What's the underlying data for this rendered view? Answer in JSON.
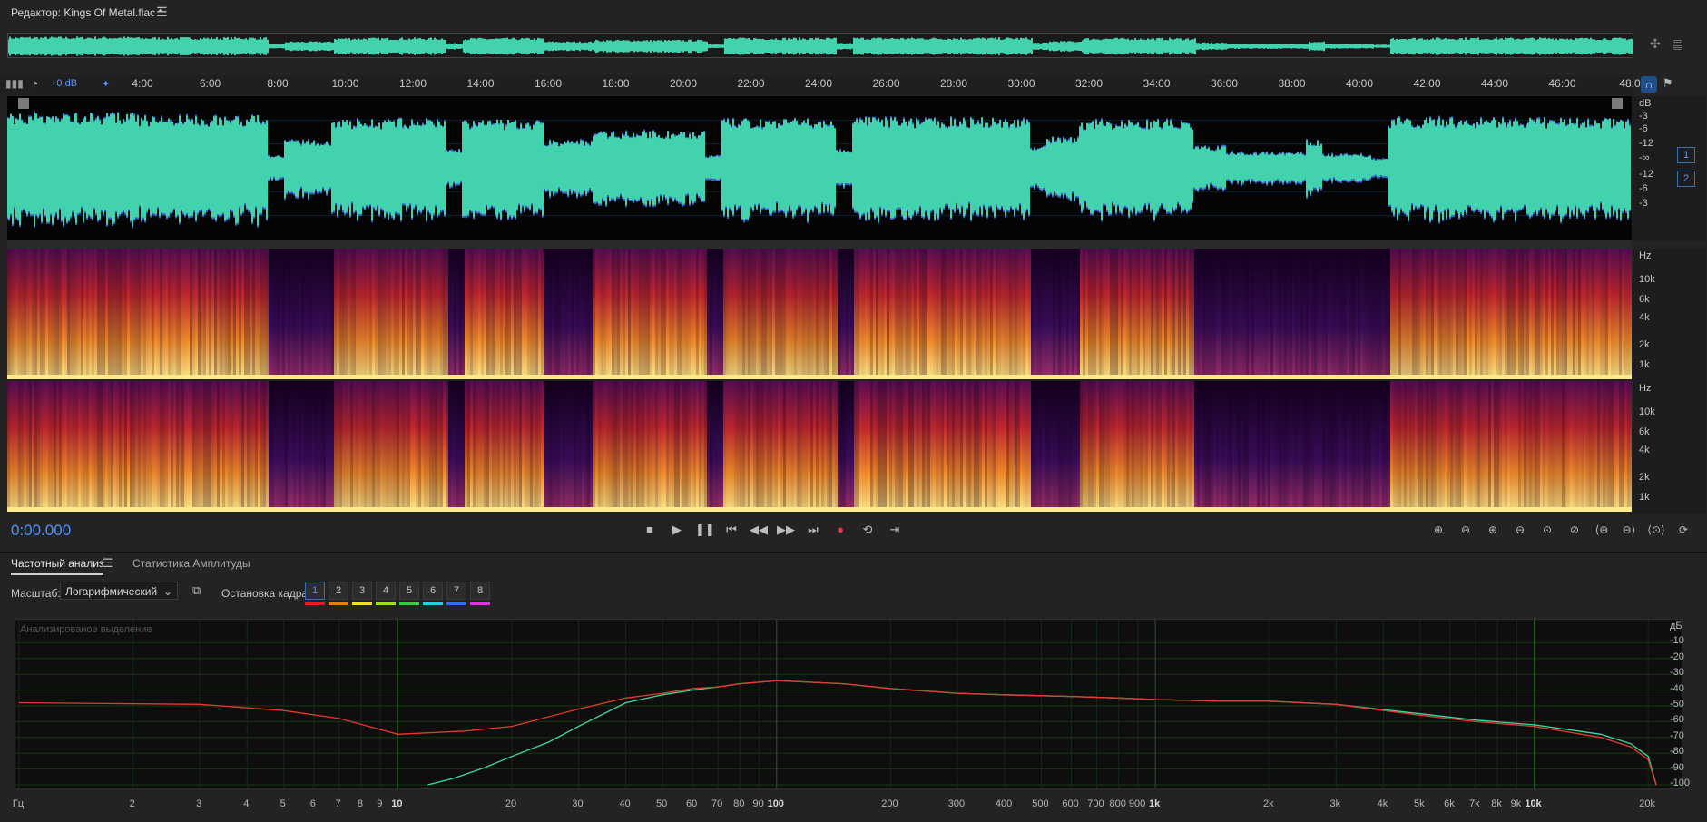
{
  "title": {
    "text": "Редактор: Kings Of Metal.flac *",
    "menu_icon": "hamburger-menu-icon"
  },
  "colors": {
    "waveform": "#42d3ae",
    "waveform_edge": "#3a5fd0",
    "accent": "#4c92ff",
    "curve_left": "#3dd9a3",
    "curve_right": "#e23b2e",
    "record": "#e33b3b"
  },
  "ruler": {
    "db_readout": "+0 dB",
    "labels": [
      "4:00",
      "6:00",
      "8:00",
      "10:00",
      "12:00",
      "14:00",
      "16:00",
      "18:00",
      "20:00",
      "22:00",
      "24:00",
      "26:00",
      "28:00",
      "30:00",
      "32:00",
      "34:00",
      "36:00",
      "38:00",
      "40:00",
      "42:00",
      "44:00",
      "46:00",
      "48:0"
    ]
  },
  "wave_scale": [
    "dB",
    "-3",
    "-6",
    "-12",
    "-∞",
    "-12",
    "-6",
    "-3"
  ],
  "spectral_scale": [
    "Hz",
    "10k",
    "6k",
    "4k",
    "2k",
    "1k"
  ],
  "channels": [
    "1",
    "2"
  ],
  "transport": {
    "time": "0:00.000",
    "buttons": [
      {
        "name": "stop-button",
        "icon": "■"
      },
      {
        "name": "play-button",
        "icon": "▶"
      },
      {
        "name": "pause-button",
        "icon": "❚❚"
      },
      {
        "name": "skip-to-start-button",
        "icon": "⏮"
      },
      {
        "name": "rewind-button",
        "icon": "◀◀"
      },
      {
        "name": "fast-forward-button",
        "icon": "▶▶"
      },
      {
        "name": "skip-to-end-button",
        "icon": "⏭"
      },
      {
        "name": "record-button",
        "icon": "●"
      },
      {
        "name": "loop-button",
        "icon": "⟲"
      },
      {
        "name": "skip-selection-button",
        "icon": "⇥"
      }
    ],
    "zoom_buttons": [
      {
        "name": "zoom-in-amplitude-button",
        "icon": "⊕"
      },
      {
        "name": "zoom-out-amplitude-button",
        "icon": "⊖"
      },
      {
        "name": "zoom-in-time-button",
        "icon": "⊕"
      },
      {
        "name": "zoom-out-time-button",
        "icon": "⊖"
      },
      {
        "name": "zoom-selection-button",
        "icon": "⊙"
      },
      {
        "name": "zoom-out-full-button",
        "icon": "⊘"
      },
      {
        "name": "zoom-in-point-button",
        "icon": "⟨⊕"
      },
      {
        "name": "zoom-out-point-button",
        "icon": "⊖⟩"
      },
      {
        "name": "zoom-reset-button",
        "icon": "⟨⊙⟩"
      },
      {
        "name": "zoom-full-button",
        "icon": "⟳"
      },
      {
        "name": "zoom-extra-button",
        "icon": "⊡"
      }
    ]
  },
  "panel": {
    "tabs": [
      {
        "label": "Частотный анализ",
        "active": true
      },
      {
        "label": "Статистика Амплитуды",
        "active": false
      }
    ],
    "scale_label": "Масштаб:",
    "scale_value": "Логарифмический",
    "freeze_label": "Остановка кадра:",
    "frames": [
      {
        "label": "1",
        "color": "#e02020"
      },
      {
        "label": "2",
        "color": "#f07c10"
      },
      {
        "label": "3",
        "color": "#f0e020"
      },
      {
        "label": "4",
        "color": "#a0e020"
      },
      {
        "label": "5",
        "color": "#30d040"
      },
      {
        "label": "6",
        "color": "#20d0e0"
      },
      {
        "label": "7",
        "color": "#3070f0"
      },
      {
        "label": "8",
        "color": "#e030e0"
      }
    ]
  },
  "freq_analysis": {
    "caption": "Анализированое выделение",
    "db_labels": [
      "дБ",
      "-10",
      "-20",
      "-30",
      "-40",
      "-50",
      "-60",
      "-70",
      "-80",
      "-90",
      "-100"
    ],
    "x_labels": [
      {
        "t": "Гц",
        "f": 1.0
      },
      {
        "t": "2",
        "f": 2
      },
      {
        "t": "3",
        "f": 3
      },
      {
        "t": "4",
        "f": 4
      },
      {
        "t": "5",
        "f": 5
      },
      {
        "t": "6",
        "f": 6
      },
      {
        "t": "7",
        "f": 7
      },
      {
        "t": "8",
        "f": 8
      },
      {
        "t": "9",
        "f": 9
      },
      {
        "t": "10",
        "f": 10,
        "b": true
      },
      {
        "t": "20",
        "f": 20
      },
      {
        "t": "30",
        "f": 30
      },
      {
        "t": "40",
        "f": 40
      },
      {
        "t": "50",
        "f": 50
      },
      {
        "t": "60",
        "f": 60
      },
      {
        "t": "70",
        "f": 70
      },
      {
        "t": "80",
        "f": 80
      },
      {
        "t": "90",
        "f": 90
      },
      {
        "t": "100",
        "f": 100,
        "b": true
      },
      {
        "t": "200",
        "f": 200
      },
      {
        "t": "300",
        "f": 300
      },
      {
        "t": "400",
        "f": 400
      },
      {
        "t": "500",
        "f": 500
      },
      {
        "t": "600",
        "f": 600
      },
      {
        "t": "700",
        "f": 700
      },
      {
        "t": "800",
        "f": 800
      },
      {
        "t": "900",
        "f": 900
      },
      {
        "t": "1k",
        "f": 1000,
        "b": true
      },
      {
        "t": "2k",
        "f": 2000
      },
      {
        "t": "3k",
        "f": 3000
      },
      {
        "t": "4k",
        "f": 4000
      },
      {
        "t": "5k",
        "f": 5000
      },
      {
        "t": "6k",
        "f": 6000
      },
      {
        "t": "7k",
        "f": 7000
      },
      {
        "t": "8k",
        "f": 8000
      },
      {
        "t": "9k",
        "f": 9000
      },
      {
        "t": "10k",
        "f": 10000,
        "b": true
      },
      {
        "t": "20k",
        "f": 20000
      }
    ],
    "left_curve": [
      [
        12,
        -100
      ],
      [
        14,
        -96
      ],
      [
        17,
        -89
      ],
      [
        20,
        -82
      ],
      [
        25,
        -73
      ],
      [
        30,
        -63
      ],
      [
        40,
        -48
      ],
      [
        50,
        -43
      ],
      [
        60,
        -40
      ],
      [
        70,
        -38
      ],
      [
        80,
        -36
      ],
      [
        90,
        -35
      ],
      [
        100,
        -34
      ],
      [
        150,
        -36
      ],
      [
        200,
        -39
      ],
      [
        300,
        -42
      ],
      [
        400,
        -43
      ],
      [
        600,
        -44
      ],
      [
        800,
        -45
      ],
      [
        1000,
        -46
      ],
      [
        1500,
        -47
      ],
      [
        2000,
        -47
      ],
      [
        3000,
        -49
      ],
      [
        5000,
        -55
      ],
      [
        7000,
        -59
      ],
      [
        10000,
        -62
      ],
      [
        15000,
        -68
      ],
      [
        18000,
        -74
      ],
      [
        20000,
        -82
      ],
      [
        21000,
        -100
      ]
    ],
    "right_curve": [
      [
        1,
        -48
      ],
      [
        3,
        -49
      ],
      [
        5,
        -53
      ],
      [
        7,
        -58
      ],
      [
        10,
        -68
      ],
      [
        15,
        -66
      ],
      [
        20,
        -63
      ],
      [
        30,
        -52
      ],
      [
        40,
        -45
      ],
      [
        50,
        -42
      ],
      [
        60,
        -39
      ],
      [
        70,
        -38
      ],
      [
        80,
        -36
      ],
      [
        90,
        -35
      ],
      [
        100,
        -34
      ],
      [
        150,
        -36
      ],
      [
        200,
        -39
      ],
      [
        300,
        -42
      ],
      [
        400,
        -43
      ],
      [
        600,
        -44
      ],
      [
        800,
        -45
      ],
      [
        1000,
        -46
      ],
      [
        1500,
        -47
      ],
      [
        2000,
        -47
      ],
      [
        3000,
        -49
      ],
      [
        5000,
        -56
      ],
      [
        7000,
        -60
      ],
      [
        10000,
        -63
      ],
      [
        15000,
        -70
      ],
      [
        18000,
        -76
      ],
      [
        20000,
        -84
      ],
      [
        21000,
        -100
      ]
    ]
  }
}
